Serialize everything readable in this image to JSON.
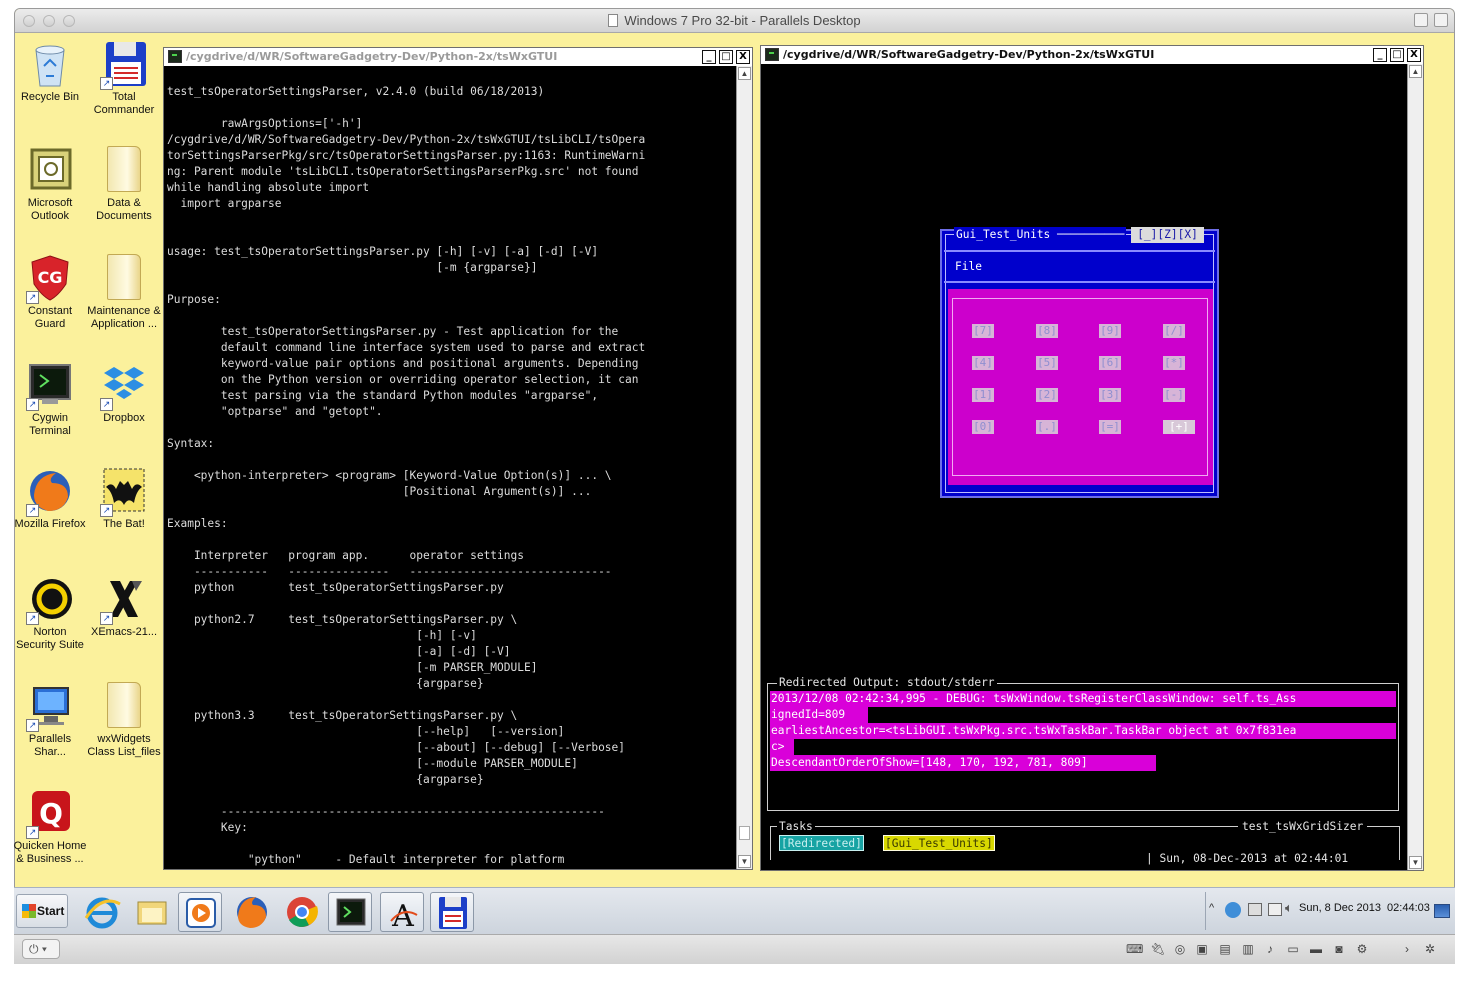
{
  "mac_window": {
    "title": "Windows 7 Pro 32-bit - Parallels Desktop"
  },
  "desktop_icons": [
    {
      "label": "Recycle Bin"
    },
    {
      "label": "Total\nCommander"
    },
    {
      "label": "Microsoft\nOutlook"
    },
    {
      "label": "Data &\nDocuments"
    },
    {
      "label": "Constant\nGuard"
    },
    {
      "label": "Maintenance &\nApplication ..."
    },
    {
      "label": "Cygwin\nTerminal"
    },
    {
      "label": "Dropbox"
    },
    {
      "label": "Mozilla Firefox"
    },
    {
      "label": "The Bat!"
    },
    {
      "label": "Norton\nSecurity Suite"
    },
    {
      "label": "XEmacs-21..."
    },
    {
      "label": "Parallels\nShar..."
    },
    {
      "label": "wxWidgets\nClass List_files"
    },
    {
      "label": "Quicken Home\n& Business ..."
    }
  ],
  "left_terminal": {
    "title": "/cygdrive/d/WR/SoftwareGadgetry-Dev/Python-2x/tsWxGTUI",
    "controls": [
      "_",
      "□",
      "X"
    ],
    "text": "\ntest_tsOperatorSettingsParser, v2.4.0 (build 06/18/2013)\n\n        rawArgsOptions=['-h']\n/cygdrive/d/WR/SoftwareGadgetry-Dev/Python-2x/tsWxGTUI/tsLibCLI/tsOpera\ntorSettingsParserPkg/src/tsOperatorSettingsParser.py:1163: RuntimeWarni\nng: Parent module 'tsLibCLI.tsOperatorSettingsParserPkg.src' not found\nwhile handling absolute import\n  import argparse\n\n\nusage: test_tsOperatorSettingsParser.py [-h] [-v] [-a] [-d] [-V]\n                                        [-m {argparse}]\n\nPurpose:\n\n        test_tsOperatorSettingsParser.py - Test application for the\n        default command line interface system used to parse and extract\n        keyword-value pair options and positional arguments. Depending\n        on the Python version or overriding operator selection, it can\n        test parsing via the standard Python modules \"argparse\",\n        \"optparse\" and \"getopt\".\n\nSyntax:\n\n    <python-interpreter> <program> [Keyword-Value Option(s)] ... \\\n                                   [Positional Argument(s)] ...\n\nExamples:\n\n    Interpreter   program app.      operator settings\n    -----------   ---------------   ------------------------------\n    python        test_tsOperatorSettingsParser.py\n\n    python2.7     test_tsOperatorSettingsParser.py \\\n                                     [-h] [-v]\n                                     [-a] [-d] [-V]\n                                     [-m PARSER_MODULE]\n                                     {argparse}\n\n    python3.3     test_tsOperatorSettingsParser.py \\\n                                     [--help]   [--version]\n                                     [--about] [--debug] [--Verbose]\n                                     [--module PARSER_MODULE]\n                                     {argparse}\n\n        ---------------------------------------------------------\n        Key:\n\n            \"python\"     - Default interpreter for platform"
  },
  "right_terminal": {
    "title": "/cygdrive/d/WR/SoftwareGadgetry-Dev/Python-2x/tsWxGTUI",
    "controls": [
      "_",
      "□",
      "X"
    ]
  },
  "gui_window": {
    "title": "Gui_Test_Units",
    "title_line": "Gui_Test_Units ──────────",
    "window_buttons": "[_][Z][X]",
    "menu_file": "File",
    "keypad": [
      "[7]",
      "[8]",
      "[9]",
      "[/]",
      "[4]",
      "[5]",
      "[6]",
      "[*]",
      "[1]",
      "[2]",
      "[3]",
      "[-]",
      "[0]",
      "[.]",
      "[=]",
      "[+]"
    ]
  },
  "redirected": {
    "header": "Redirected Output: stdout/stderr",
    "lines": [
      "2013/12/08 02:42:34,995 - DEBUG: tsWxWindow.tsRegisterClassWindow: self.ts_Ass",
      "ignedId=809",
      "earliestAncestor=<tsLibGUI.tsWxPkg.src.tsWxTaskBar.TaskBar object at 0x7f831ea",
      "c>",
      "DescendantOrderOfShow=[148, 170, 192, 781, 809]"
    ]
  },
  "tasks_panel": {
    "header": "Tasks",
    "app_name": "test_tsWxGridSizer",
    "task_buttons": [
      "[Redirected]",
      "[Gui_Test_Units]"
    ],
    "datetime": "| Sun, 08-Dec-2013 at 02:44:01"
  },
  "win_taskbar": {
    "start_label": "Start",
    "clock": "Sun, 8 Dec 2013  02:44:03",
    "tray_chevron": "^"
  },
  "colors": {
    "desktop": "#fbf19c",
    "terminal_bg": "#000000",
    "gui_blue": "#0000cc",
    "calc_magenta": "#cc00cc",
    "highlight_magenta": "#d900d9",
    "task_cyan": "#17a3a3",
    "task_yellow": "#d8d800"
  }
}
